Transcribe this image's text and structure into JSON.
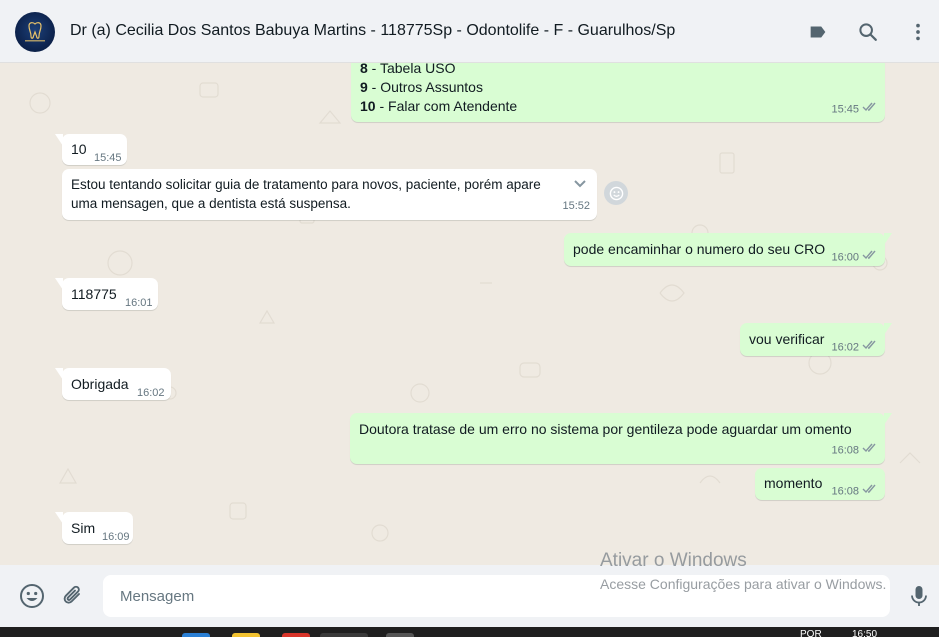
{
  "header": {
    "title": "Dr (a) Cecilia Dos Santos Babuya Martins - 118775Sp - Odontolife - F - Guarulhos/Sp",
    "icons": [
      "label-icon",
      "search-icon",
      "more-vert-icon"
    ]
  },
  "messages": [
    {
      "direction": "out",
      "lines": [
        {
          "bold": "8",
          "text": " - Tabela USO"
        },
        {
          "bold": "9",
          "text": " - Outros Assuntos"
        },
        {
          "bold": "10",
          "text": " - Falar com Atendente"
        }
      ],
      "time": "15:45",
      "status": "read"
    },
    {
      "direction": "in",
      "text": "10",
      "time": "15:45"
    },
    {
      "direction": "in",
      "text_line1": "Estou tentando solicitar guia de tratamento para novos, paciente, porém apare",
      "text_line2": "uma mensagen, que a dentista está suspensa.",
      "time": "15:52"
    },
    {
      "direction": "out",
      "text": "pode encaminhar o numero do seu CRO",
      "time": "16:00",
      "status": "read"
    },
    {
      "direction": "in",
      "text": "118775",
      "time": "16:01"
    },
    {
      "direction": "out",
      "text": "vou verificar",
      "time": "16:02",
      "status": "read"
    },
    {
      "direction": "in",
      "text": "Obrigada",
      "time": "16:02"
    },
    {
      "direction": "out",
      "text": "Doutora tratase de um erro no sistema por gentileza pode aguardar um omento",
      "time": "16:08",
      "status": "read"
    },
    {
      "direction": "out",
      "text": "momento",
      "time": "16:08",
      "status": "read"
    },
    {
      "direction": "in",
      "text": "Sim",
      "time": "16:09"
    }
  ],
  "composer": {
    "placeholder": "Mensagem",
    "icons": [
      "emoji-icon",
      "attach-icon",
      "mic-icon"
    ]
  },
  "watermark": {
    "line1": "Ativar o Windows",
    "line2": "Acesse Configurações para ativar o Windows."
  },
  "taskbar": {
    "lang": "POR",
    "clock": "16:50"
  },
  "colors": {
    "chat_bg": "#efeae2",
    "bubble_out": "#d9fdd3",
    "bubble_in": "#ffffff",
    "header_bg": "#f0f2f5"
  }
}
